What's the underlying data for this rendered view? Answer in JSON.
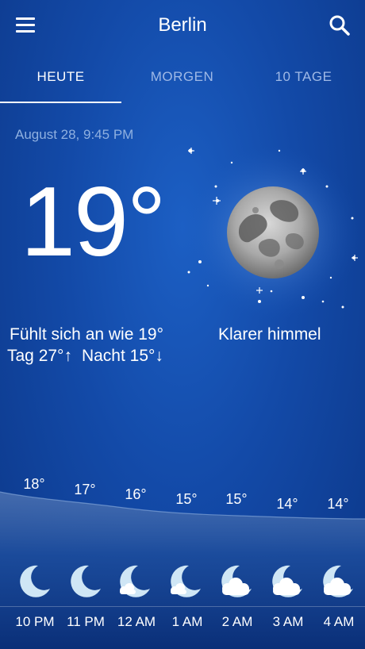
{
  "header": {
    "city": "Berlin",
    "menu_icon": "hamburger-menu-icon",
    "search_icon": "search-icon"
  },
  "tabs": [
    {
      "label": "HEUTE",
      "active": true
    },
    {
      "label": "MORGEN",
      "active": false
    },
    {
      "label": "10 TAGE",
      "active": false
    }
  ],
  "current": {
    "datetime": "August 28, 9:45 PM",
    "temperature": "19°",
    "feels_like": "Fühlt sich an wie 19°",
    "day": "Tag 27°↑",
    "night": "Nacht 15°↓",
    "condition": "Klarer himmel",
    "icon": "moon-clear-night-icon"
  },
  "hourly": [
    {
      "time": "10 PM",
      "temp": "18°",
      "icon": "moon-icon"
    },
    {
      "time": "11 PM",
      "temp": "17°",
      "icon": "moon-icon"
    },
    {
      "time": "12 AM",
      "temp": "16°",
      "icon": "moon-small-cloud-icon"
    },
    {
      "time": "1 AM",
      "temp": "15°",
      "icon": "moon-small-cloud-icon"
    },
    {
      "time": "2 AM",
      "temp": "15°",
      "icon": "moon-cloud-icon"
    },
    {
      "time": "3 AM",
      "temp": "14°",
      "icon": "moon-cloud-icon"
    },
    {
      "time": "4 AM",
      "temp": "14°",
      "icon": "moon-cloud-icon"
    }
  ],
  "colors": {
    "background_top": "#1c5fc4",
    "background_bottom": "#0c3788",
    "tab_inactive": "#9fb9e6",
    "date_text": "#8fb0e0",
    "icon_moon": "#cfe6f5"
  }
}
